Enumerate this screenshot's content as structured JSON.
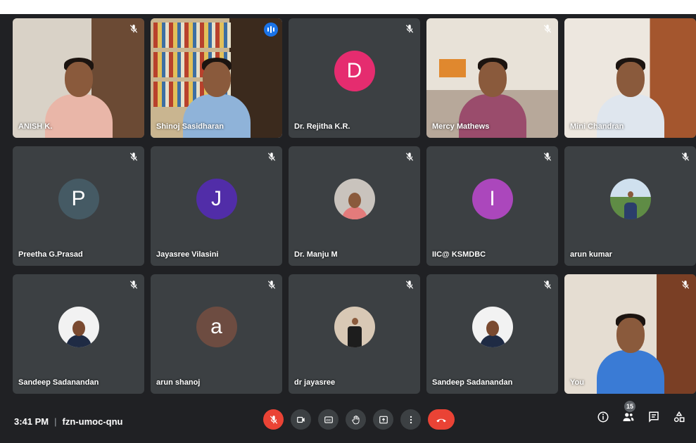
{
  "meeting": {
    "time": "3:41 PM",
    "code": "fzn-umoc-qnu",
    "participant_count": "15"
  },
  "participants": [
    {
      "name": "ANISH K.",
      "type": "video"
    },
    {
      "name": "Shinoj Sasidharan",
      "type": "video",
      "speaking": true
    },
    {
      "name": "Dr. Rejitha K.R.",
      "type": "avatar",
      "initial": "D",
      "color": "#e52c6f"
    },
    {
      "name": "Mercy Mathews",
      "type": "video"
    },
    {
      "name": "Mini Chandran",
      "type": "video"
    },
    {
      "name": "Preetha G.Prasad",
      "type": "avatar",
      "initial": "P",
      "color": "#455a64"
    },
    {
      "name": "Jayasree Vilasini",
      "type": "avatar",
      "initial": "J",
      "color": "#512da8"
    },
    {
      "name": "Dr. Manju M",
      "type": "photo-avatar"
    },
    {
      "name": "IIC@ KSMDBC",
      "type": "avatar",
      "initial": "I",
      "color": "#ab47bc"
    },
    {
      "name": "arun kumar",
      "type": "photo-avatar"
    },
    {
      "name": "Sandeep Sadanandan",
      "type": "photo-avatar"
    },
    {
      "name": "arun shanoj",
      "type": "avatar",
      "initial": "a",
      "color": "#6d4c41"
    },
    {
      "name": "dr jayasree",
      "type": "photo-avatar"
    },
    {
      "name": "Sandeep Sadanandan",
      "type": "photo-avatar"
    },
    {
      "name": "You",
      "type": "video"
    }
  ],
  "controls": {
    "mic": "mic-off-icon",
    "camera": "camera-icon",
    "captions": "captions-icon",
    "raise_hand": "hand-icon",
    "present": "present-icon",
    "more": "more-vert-icon",
    "leave": "call-end-icon"
  },
  "colors": {
    "background": "#202124",
    "tile": "#3c4043",
    "danger": "#ea4335",
    "speaking": "#1a73e8"
  }
}
